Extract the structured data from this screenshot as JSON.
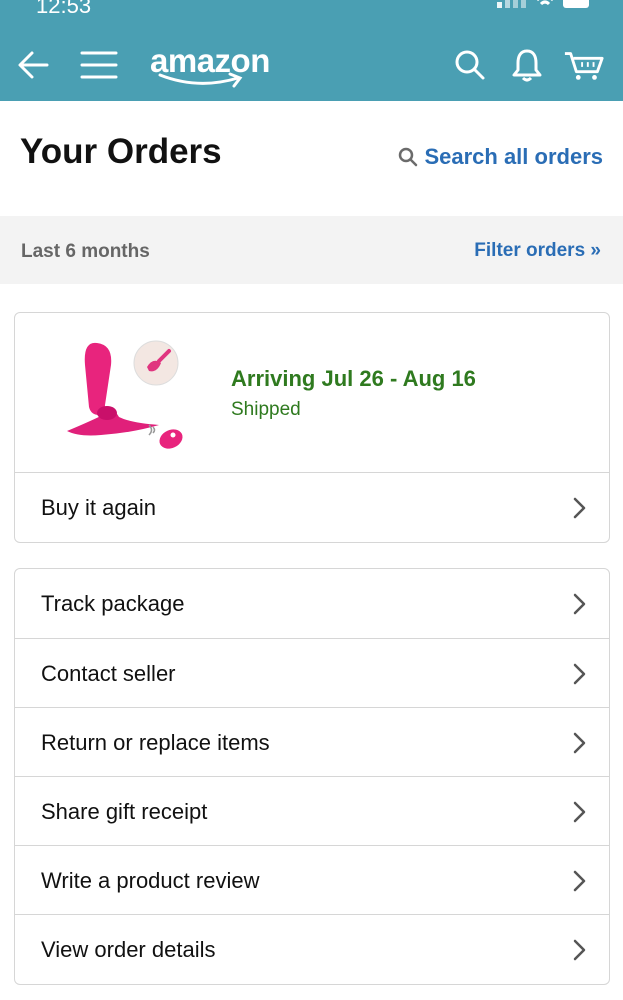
{
  "status_bar": {
    "time": "12:53"
  },
  "nav": {
    "back_icon": "back-arrow-icon",
    "menu_icon": "hamburger-menu-icon",
    "logo_text": "amazon",
    "search_icon": "search-icon",
    "notifications_icon": "bell-icon",
    "cart_icon": "cart-icon"
  },
  "header": {
    "title": "Your Orders",
    "search_label": "Search all orders"
  },
  "filter": {
    "range": "Last 6 months",
    "filter_label": "Filter orders »"
  },
  "order": {
    "arrival": "Arriving Jul 26 - Aug 16",
    "status": "Shipped",
    "buy_again": "Buy it again"
  },
  "actions": [
    "Track package",
    "Contact seller",
    "Return or replace items",
    "Share gift receipt",
    "Write a product review",
    "View order details"
  ],
  "colors": {
    "topbar": "#4a9fb3",
    "link": "#2a6db5",
    "success": "#2f7a1f"
  }
}
